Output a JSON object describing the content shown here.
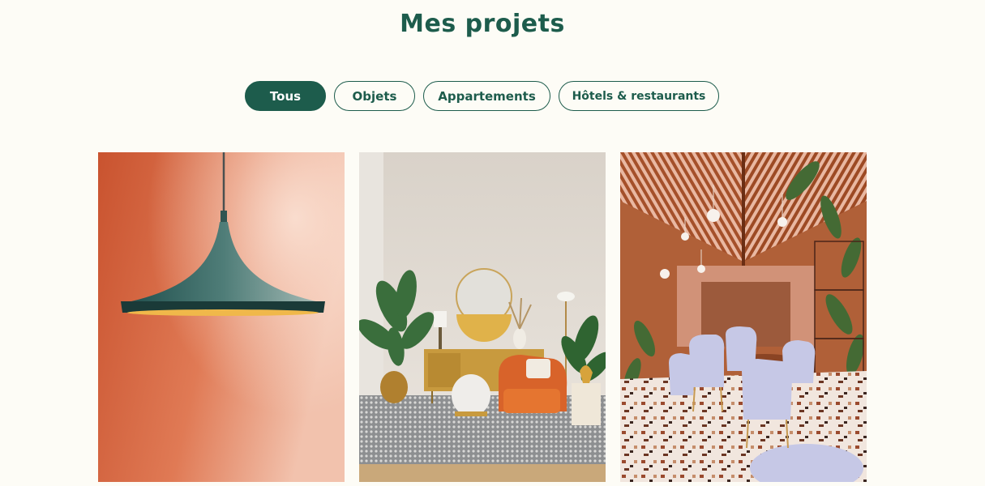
{
  "section": {
    "title": "Mes projets"
  },
  "filters": [
    {
      "label": "Tous",
      "active": true
    },
    {
      "label": "Objets",
      "active": false
    },
    {
      "label": "Appartements",
      "active": false
    },
    {
      "label": "Hôtels & restaurants",
      "active": false
    }
  ],
  "colors": {
    "brand_green": "#1d5c4c",
    "background": "#fdfcf6"
  },
  "projects": [
    {
      "image": "pendant-lamp-photo"
    },
    {
      "image": "living-room-photo"
    },
    {
      "image": "restaurant-photo"
    }
  ]
}
